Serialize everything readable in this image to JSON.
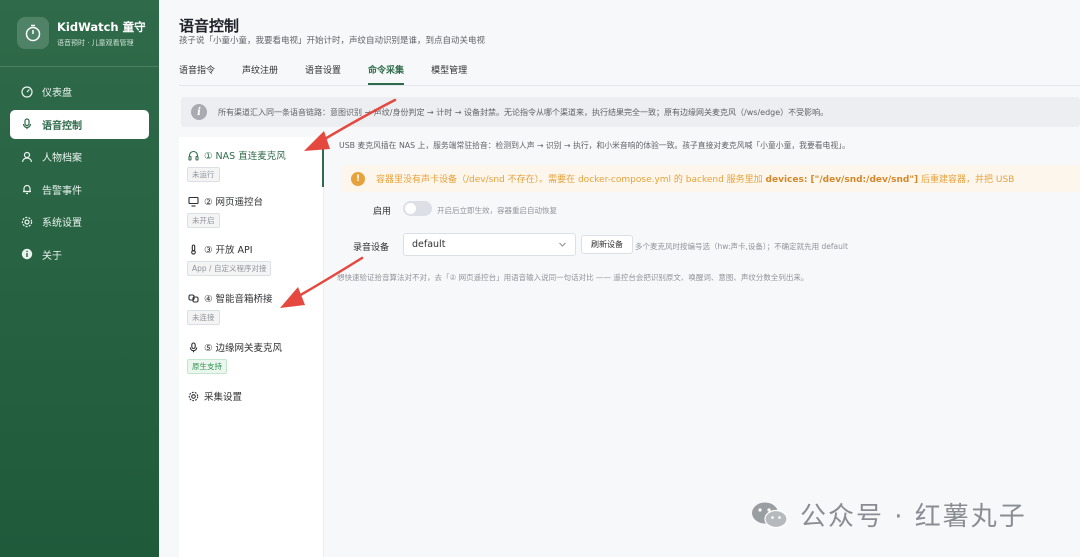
{
  "brand": {
    "title": "KidWatch 童守",
    "subtitle": "语音预时 · 儿童观看管理"
  },
  "sidebar": {
    "items": [
      {
        "label": "仪表盘",
        "icon": "dashboard-icon"
      },
      {
        "label": "语音控制",
        "icon": "microphone-icon",
        "active": true
      },
      {
        "label": "人物档案",
        "icon": "user-icon"
      },
      {
        "label": "告警事件",
        "icon": "bell-icon"
      },
      {
        "label": "系统设置",
        "icon": "gear-icon"
      },
      {
        "label": "关于",
        "icon": "info-icon"
      }
    ]
  },
  "header": {
    "title": "语音控制",
    "subtitle": "孩子说「小童小童，我要看电视」开始计时，声纹自动识别是谁，到点自动关电视"
  },
  "tabs": [
    {
      "label": "语音指令"
    },
    {
      "label": "声纹注册"
    },
    {
      "label": "语音设置"
    },
    {
      "label": "命令采集",
      "active": true
    },
    {
      "label": "模型管理"
    }
  ],
  "info_bar": {
    "text": "所有渠道汇入同一条语音链路：意图识别 → 声纹/身份判定 → 计时 → 设备封禁。无论指令从哪个渠道来，执行结果完全一致；原有边缘网关麦克风（/ws/edge）不受影响。"
  },
  "channels": [
    {
      "label": "① NAS 直连麦克风",
      "tag": "未运行",
      "icon": "headphones-icon",
      "active": true
    },
    {
      "label": "② 网页遥控台",
      "tag": "未开启",
      "icon": "monitor-icon"
    },
    {
      "label": "③ 开放 API",
      "tag": "App / 自定义程序对接",
      "icon": "thermometer-icon"
    },
    {
      "label": "④ 智能音箱桥接",
      "tag": "未连接",
      "icon": "link-icon"
    },
    {
      "label": "⑤ 边缘网关麦克风",
      "tag": "原生支持",
      "tag_color": "green",
      "icon": "microphone-icon"
    },
    {
      "label": "采集设置",
      "icon": "gear-icon"
    }
  ],
  "content": {
    "description": "USB 麦克风插在 NAS 上，服务端常驻拾音：检测到人声 → 识别 → 执行，和小米音响的体验一致。孩子直接对麦克风喊「小童小童，我要看电视」。",
    "warning_prefix": "容器里没有声卡设备（/dev/snd 不存在）。需要在 docker-compose.yml 的 backend 服务里加 ",
    "warning_bold": "devices: [\"/dev/snd:/dev/snd\"]",
    "warning_suffix": " 后重建容器，并把 USB",
    "enable_label": "启用",
    "enable_hint": "开启后立即生效，容器重启自动恢复",
    "record_label": "录音设备",
    "record_value": "default",
    "refresh_button": "刷新设备",
    "record_hint": "多个麦克风时按编号选（hw:声卡,设备）；不确定就先用 default",
    "footer_note": "想快速验证拾音算法对不对，去「② 网页遥控台」用语音输入说同一句话对比 —— 遥控台会把识别原文、唤醒词、意图、声纹分数全列出来。"
  },
  "watermark": {
    "text": "公众号 · 红薯丸子"
  },
  "colors": {
    "sidebar": "#2f6b4a",
    "accent": "#2f6b4a",
    "warning": "#e6a23c",
    "annotation_arrow": "#e5483f"
  }
}
